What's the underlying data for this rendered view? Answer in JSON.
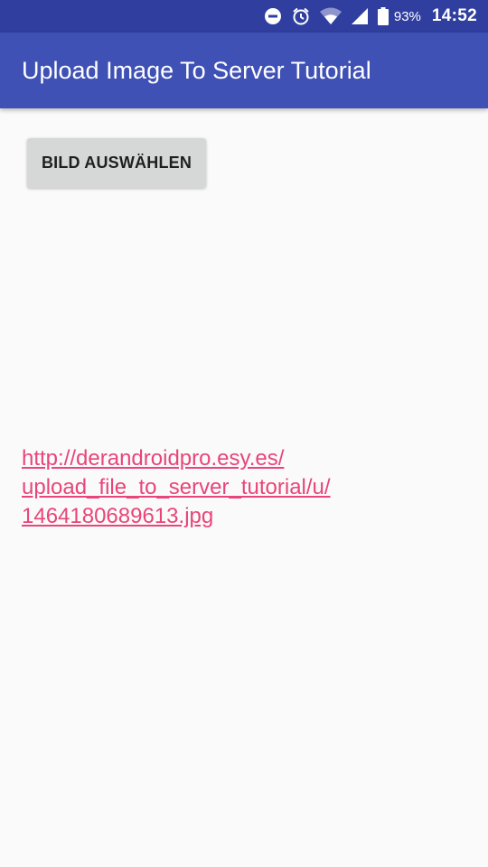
{
  "status_bar": {
    "icons": [
      "do-not-disturb-icon",
      "alarm-icon",
      "wifi-icon",
      "signal-icon",
      "battery-icon"
    ],
    "battery": "93%",
    "time": "14:52"
  },
  "app_bar": {
    "title": "Upload Image To Server Tutorial"
  },
  "main": {
    "select_button_label": "BILD AUSWÄHLEN",
    "link_lines": [
      "http://derandroidpro.esy.es/",
      "upload_file_to_server_tutorial/u/",
      "1464180689613.jpg"
    ]
  },
  "colors": {
    "status_bar": "#303f9f",
    "app_bar": "#3f51b5",
    "background": "#fafafa",
    "button": "#d6d7d7",
    "link": "#e8457a"
  }
}
